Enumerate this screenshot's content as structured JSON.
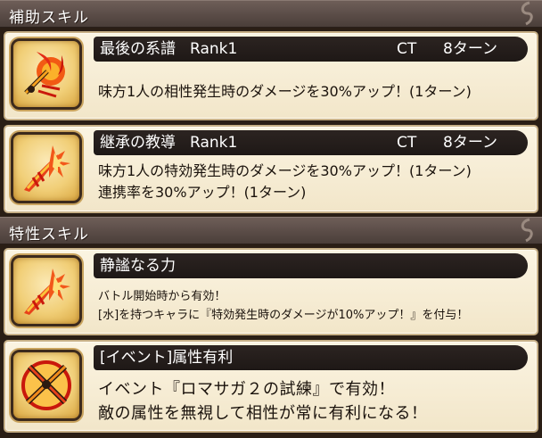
{
  "sections": {
    "support": {
      "title": "補助スキル"
    },
    "trait": {
      "title": "特性スキル"
    }
  },
  "support_skills": [
    {
      "name": "最後の系譜",
      "rank": "Rank1",
      "ct_label": "CT",
      "ct_value": "8ターン",
      "icon": "flame-burst-skill-icon",
      "desc": [
        "味方1人の相性発生時のダメージを30%アップ！(1ターン)"
      ]
    },
    {
      "name": "継承の教導",
      "rank": "Rank1",
      "ct_label": "CT",
      "ct_value": "8ターン",
      "icon": "flame-slash-skill-icon",
      "desc": [
        "味方1人の特効発生時のダメージを30%アップ！(1ターン)",
        "連携率を30%アップ！(1ターン)"
      ]
    }
  ],
  "trait_skills": [
    {
      "name": "静謐なる力",
      "icon": "flame-slash-skill-icon",
      "desc": [
        "バトル開始時から有効！",
        "[水]を持つキャラに『特効発生時のダメージが10%アップ！』を付与！"
      ]
    },
    {
      "name": "[イベント]属性有利",
      "icon": "crossed-swords-skill-icon",
      "desc": [
        "イベント『ロマサガ２の試練』で有効！",
        "敵の属性を無視して相性が常に有利になる！"
      ]
    }
  ],
  "colors": {
    "header": "#5a4c47",
    "card_bg": "#f7eed8",
    "namebar": "#241d1a",
    "icon_gold": "#f1cf78",
    "flame": "#e8421a"
  }
}
